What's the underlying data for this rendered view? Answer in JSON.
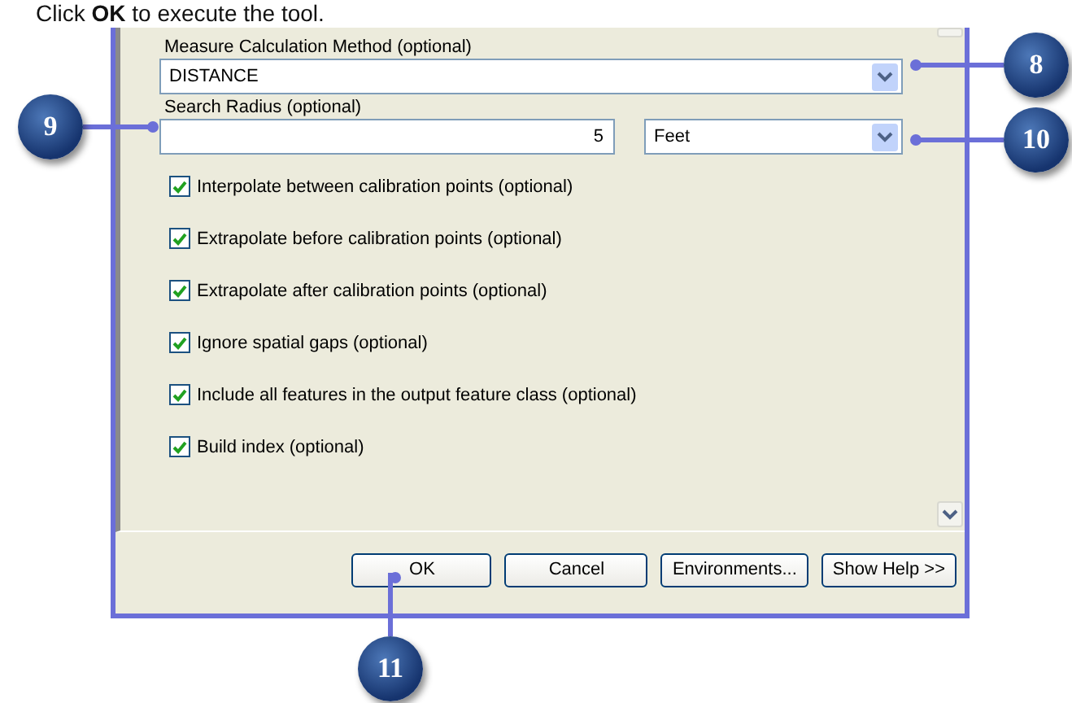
{
  "instruction": "Click **OK** to execute the tool.",
  "measure_method": {
    "label": "Measure Calculation Method (optional)",
    "value": "DISTANCE"
  },
  "search_radius": {
    "label": "Search Radius (optional)",
    "value": "5",
    "unit": "Feet"
  },
  "options": [
    {
      "label": "Interpolate between calibration points (optional)",
      "checked": true
    },
    {
      "label": "Extrapolate before calibration points (optional)",
      "checked": true
    },
    {
      "label": "Extrapolate after calibration points (optional)",
      "checked": true
    },
    {
      "label": "Ignore spatial gaps (optional)",
      "checked": true
    },
    {
      "label": "Include all features in the output feature class (optional)",
      "checked": true
    },
    {
      "label": "Build index (optional)",
      "checked": true
    }
  ],
  "buttons": [
    "OK",
    "Cancel",
    "Environments...",
    "Show Help >>"
  ],
  "callouts": [
    {
      "number": "8"
    },
    {
      "number": "9"
    },
    {
      "number": "10"
    },
    {
      "number": "11"
    }
  ]
}
